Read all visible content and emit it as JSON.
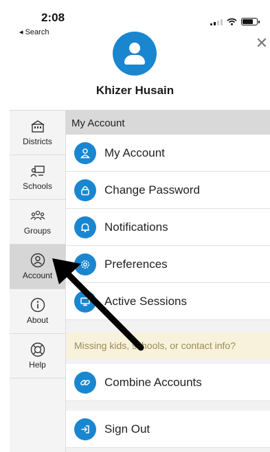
{
  "status_bar": {
    "time": "2:08",
    "back_label": "◂ Search"
  },
  "profile": {
    "name": "Khizer Husain"
  },
  "sidebar": {
    "items": [
      {
        "label": "Districts",
        "icon": "districts-icon"
      },
      {
        "label": "Schools",
        "icon": "schools-icon"
      },
      {
        "label": "Groups",
        "icon": "groups-icon"
      },
      {
        "label": "Account",
        "icon": "account-icon",
        "active": true
      },
      {
        "label": "About",
        "icon": "info-icon"
      },
      {
        "label": "Help",
        "icon": "help-lifebuoy-icon"
      }
    ]
  },
  "main": {
    "section_header": "My Account",
    "account_items": [
      {
        "label": "My Account",
        "icon": "user-icon"
      },
      {
        "label": "Change Password",
        "icon": "lock-icon"
      },
      {
        "label": "Notifications",
        "icon": "bell-icon"
      },
      {
        "label": "Preferences",
        "icon": "gear-icon"
      },
      {
        "label": "Active Sessions",
        "icon": "monitor-icon"
      }
    ],
    "notice": "Missing kids, schools, or contact info?",
    "combine_item": {
      "label": "Combine Accounts",
      "icon": "link-icon"
    },
    "signout_item": {
      "label": "Sign Out",
      "icon": "sign-out-icon"
    }
  },
  "colors": {
    "accent": "#1a86d0",
    "notice_bg": "#f8f2dc",
    "notice_text": "#9a8a55",
    "sidebar_active": "#d6d6d6"
  }
}
